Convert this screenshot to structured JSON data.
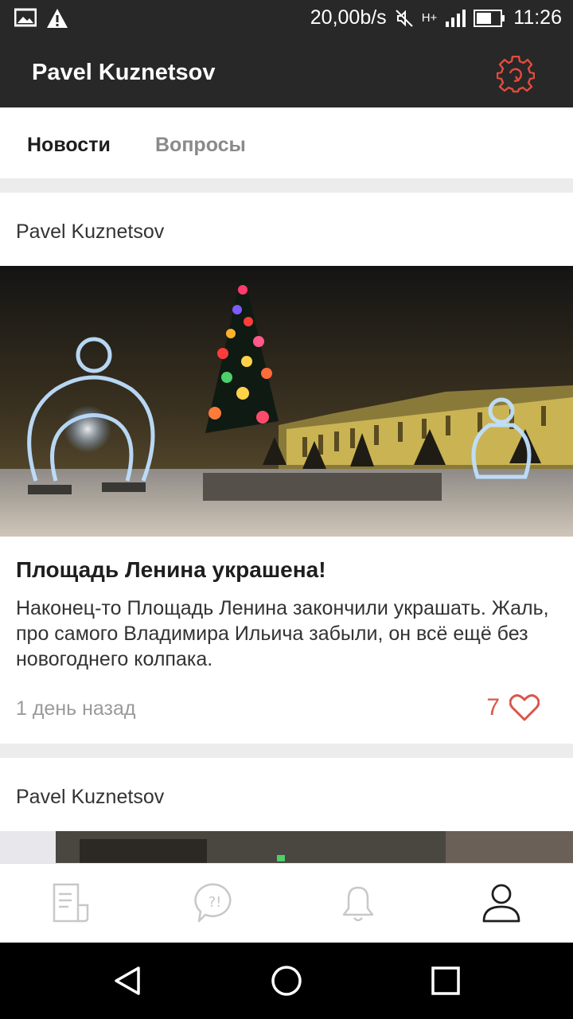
{
  "status_bar": {
    "net_speed": "20,00b/s",
    "signal_label": "H+",
    "time": "11:26",
    "icons": [
      "image-icon",
      "warning-icon",
      "mute-icon",
      "signal-icon",
      "battery-icon"
    ]
  },
  "app_bar": {
    "title": "Pavel Kuznetsov",
    "settings_icon": "settings-icon"
  },
  "tabs": [
    {
      "label": "Новости",
      "active": true
    },
    {
      "label": "Вопросы",
      "active": false
    }
  ],
  "feed": [
    {
      "author": "Pavel Kuznetsov",
      "title": "Площадь Ленина украшена!",
      "text": "Наконец-то Площадь Ленина закончили украшать. Жаль, про самого Владимира Ильича забыли, он всё ещё без новогоднего колпака.",
      "time": "1 день назад",
      "likes": "7"
    },
    {
      "author": "Pavel Kuznetsov"
    }
  ],
  "bottom_nav": [
    {
      "icon": "news-icon",
      "active": false
    },
    {
      "icon": "questions-icon",
      "active": false
    },
    {
      "icon": "bell-icon",
      "active": false
    },
    {
      "icon": "profile-icon",
      "active": true
    }
  ],
  "system_nav": [
    "back-icon",
    "home-icon",
    "recents-icon"
  ],
  "colors": {
    "app_bar": "#282828",
    "accent": "#d9574b",
    "background": "#ececec"
  }
}
